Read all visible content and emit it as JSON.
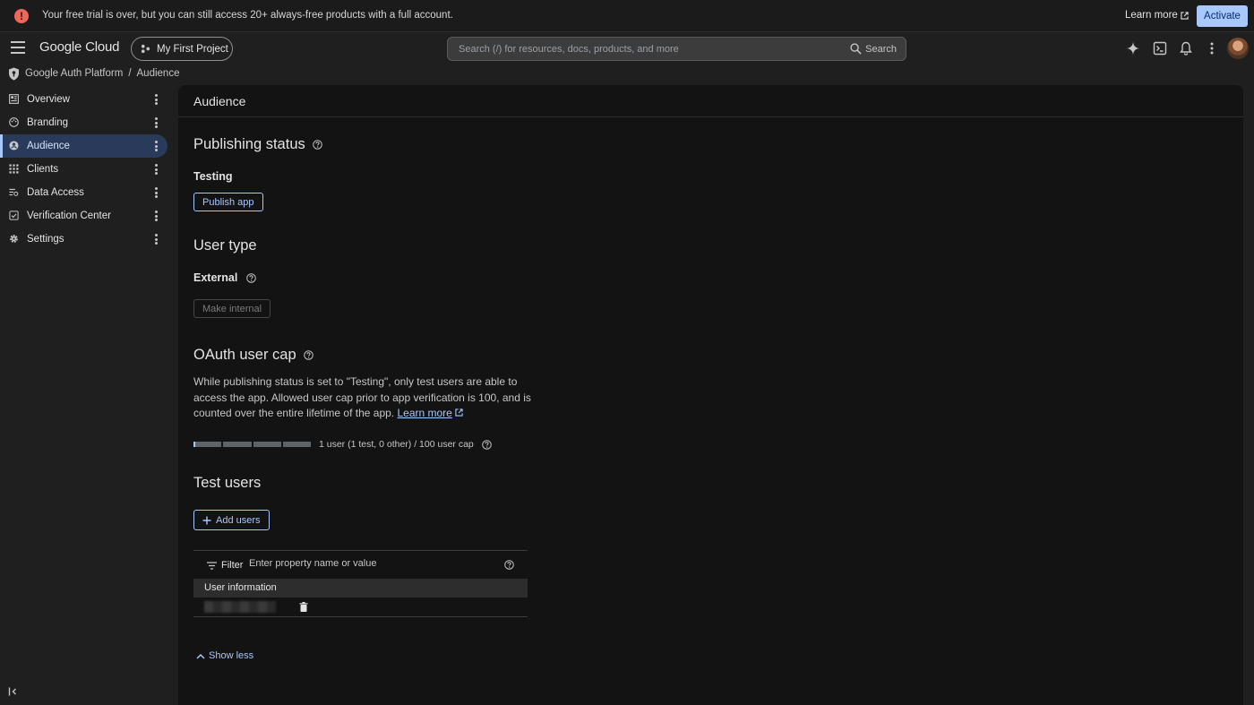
{
  "banner": {
    "message": "Your free trial is over, but you can still access 20+ always-free products with a full account.",
    "learn_more": "Learn more",
    "activate": "Activate"
  },
  "topbar": {
    "logo": "Google Cloud",
    "project": "My First Project",
    "search_placeholder": "Search (/) for resources, docs, products, and more",
    "search_button": "Search"
  },
  "breadcrumb": {
    "product": "Google Auth Platform",
    "separator": "/",
    "current": "Audience"
  },
  "sidebar": {
    "items": [
      {
        "label": "Overview",
        "icon": "dashboard-icon"
      },
      {
        "label": "Branding",
        "icon": "palette-icon"
      },
      {
        "label": "Audience",
        "icon": "account-circle-icon"
      },
      {
        "label": "Clients",
        "icon": "grid-icon"
      },
      {
        "label": "Data Access",
        "icon": "data-access-icon"
      },
      {
        "label": "Verification Center",
        "icon": "verification-icon"
      },
      {
        "label": "Settings",
        "icon": "gear-icon"
      }
    ],
    "active_index": 2
  },
  "main": {
    "title": "Audience",
    "publishing": {
      "heading": "Publishing status",
      "status": "Testing",
      "button": "Publish app"
    },
    "user_type": {
      "heading": "User type",
      "value": "External",
      "button": "Make internal"
    },
    "oauth_cap": {
      "heading": "OAuth user cap",
      "description": "While publishing status is set to \"Testing\", only test users are able to access the app. Allowed user cap prior to app verification is 100, and is counted over the entire lifetime of the app.",
      "learn_more": "Learn more",
      "cap_text": "1 user (1 test, 0 other) / 100 user cap",
      "progress_fraction": 0.01
    },
    "test_users": {
      "heading": "Test users",
      "add_button": "Add users",
      "filter_label": "Filter",
      "filter_placeholder": "Enter property name or value",
      "column_header": "User information",
      "show_less": "Show less"
    }
  },
  "colors": {
    "accent": "#a8c7fa",
    "alert": "#ee675c",
    "active_nav_bg": "#2a3a5a"
  }
}
